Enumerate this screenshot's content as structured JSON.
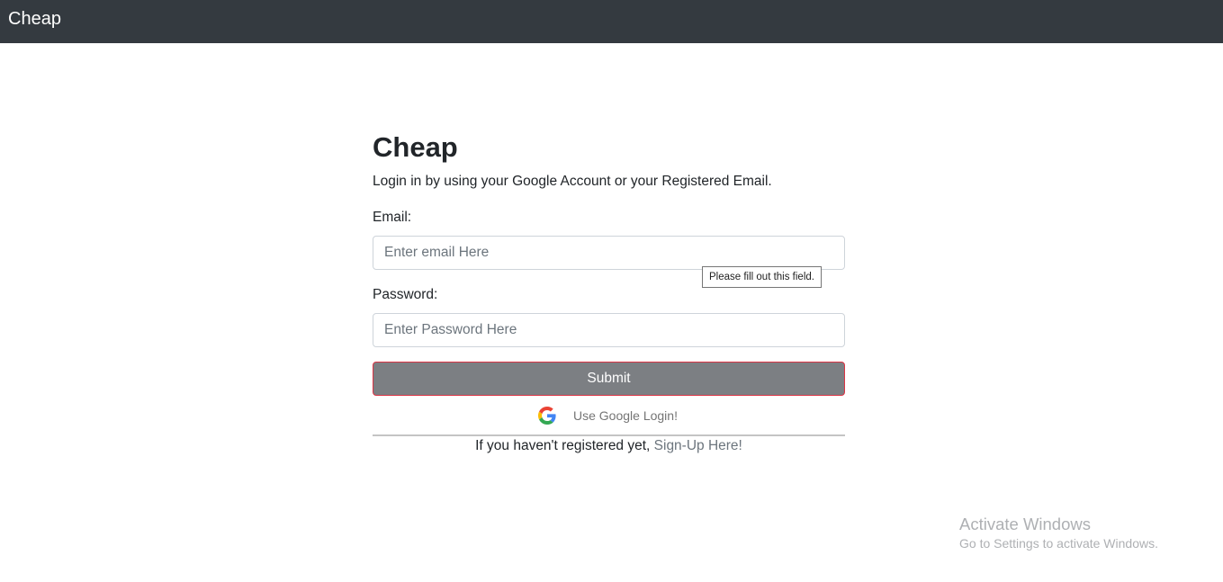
{
  "navbar": {
    "brand": "Cheap"
  },
  "form": {
    "title": "Cheap",
    "subtitle": "Login in by using your Google Account or your Registered Email.",
    "email_label": "Email:",
    "email_placeholder": "Enter email Here",
    "email_value": "",
    "validation_tooltip": "Please fill out this field.",
    "password_label": "Password:",
    "password_placeholder": "Enter Password Here",
    "password_value": "",
    "submit_label": "Submit",
    "google_label": "Use Google Login!",
    "google_icon": "google-g-icon",
    "register_text": "If you haven't registered yet,",
    "signup_link": "Sign-Up Here!"
  },
  "watermark": {
    "title": "Activate Windows",
    "subtitle": "Go to Settings to activate Windows."
  },
  "colors": {
    "navbar": "#343a40",
    "submit_bg": "#7c7f83",
    "submit_border": "#dc3545",
    "link": "#6c757d"
  }
}
